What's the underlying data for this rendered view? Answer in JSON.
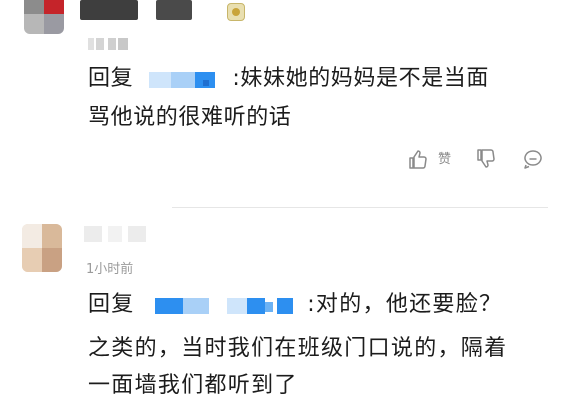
{
  "comment1": {
    "avatar_colors": [
      "#8c8c8c",
      "#c5242a",
      "#b7b7b7",
      "#9a9aa2"
    ],
    "reply_prefix": "回复",
    "text_line1": ":妹妹她的妈妈是不是当面",
    "text_line2": "骂他说的很难听的话",
    "actions": {
      "like_icon": "thumbs-up-icon",
      "zan_label": "赞",
      "dislike_icon": "thumbs-down-icon",
      "comment_icon": "comment-bubble-icon"
    }
  },
  "comment2": {
    "time": "1小时前",
    "reply_prefix": "回复",
    "text_line1": ":对的，他还要脸？",
    "text_line2": "之类的，当时我们在班级门口说的，隔着",
    "text_line3": "一面墙我们都听到了"
  },
  "colors": {
    "text": "#1c1c1c",
    "muted": "#8a8a8a",
    "mosaic_blue": "#2d8ff0",
    "divider": "#e6e6e6"
  }
}
